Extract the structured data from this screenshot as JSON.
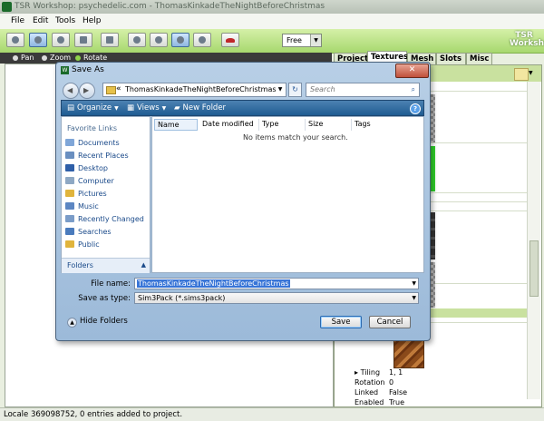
{
  "app": {
    "title": "TSR Workshop: psychedelic.com - ThomasKinkadeTheNightBeforeChristmas",
    "menu": [
      "File",
      "Edit",
      "Tools",
      "Help"
    ],
    "mode_select": "Free",
    "logo_text": "TSR Workshop",
    "view_modes": [
      "Pan",
      "Zoom",
      "Rotate"
    ],
    "selected_mode": "Rotate",
    "tabs": [
      "Project",
      "Textures",
      "Mesh",
      "Slots",
      "Misc"
    ],
    "active_tab": "Textures",
    "properties": [
      {
        "name": "Tiling",
        "value": "1, 1"
      },
      {
        "name": "Rotation",
        "value": "0"
      },
      {
        "name": "Linked",
        "value": "False"
      },
      {
        "name": "Enabled",
        "value": "True"
      }
    ],
    "status": "Locale 369098752, 0 entries added to project."
  },
  "dialog": {
    "title": "Save As",
    "path_prefix": "«",
    "path": "ThomasKinkadeTheNightBeforeChristmas",
    "search_placeholder": "Search",
    "toolbar": {
      "organize": "Organize",
      "views": "Views",
      "new_folder": "New Folder"
    },
    "favorites_header": "Favorite Links",
    "favorites": [
      "Documents",
      "Recent Places",
      "Desktop",
      "Computer",
      "Pictures",
      "Music",
      "Recently Changed",
      "Searches",
      "Public"
    ],
    "folders_label": "Folders",
    "columns": [
      "Name",
      "Date modified",
      "Type",
      "Size",
      "Tags"
    ],
    "empty_message": "No items match your search.",
    "file_name_label": "File name:",
    "file_name": "ThomasKinkadeTheNightBeforeChristmas",
    "save_as_type_label": "Save as type:",
    "save_as_type": "Sim3Pack (*.sims3pack)",
    "hide_folders": "Hide Folders",
    "save_button": "Save",
    "cancel_button": "Cancel"
  }
}
